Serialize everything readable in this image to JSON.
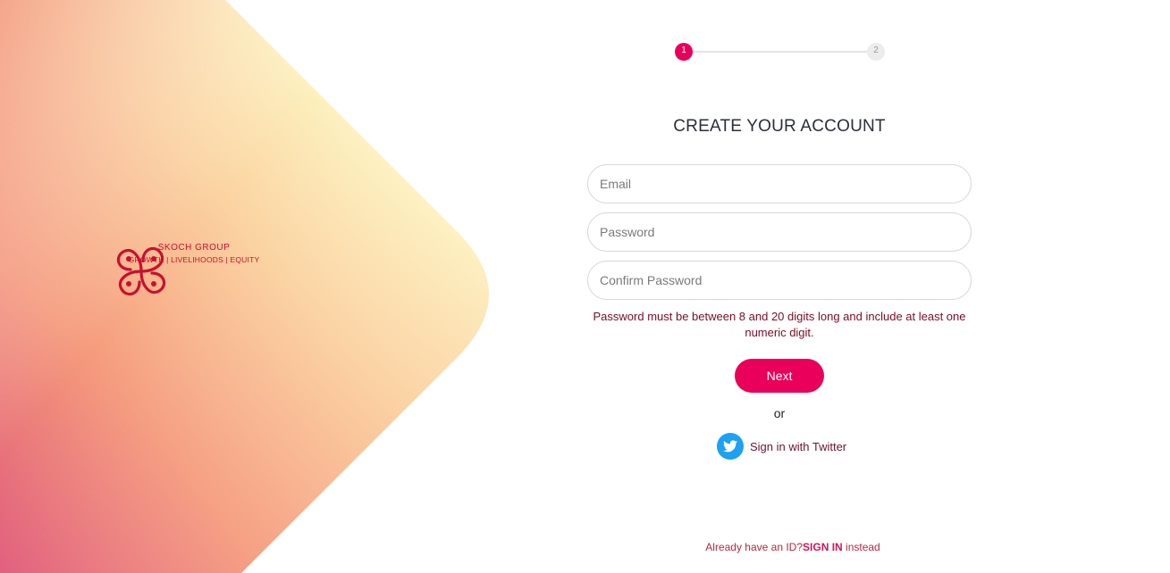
{
  "brand": {
    "name": "SKOCH GROUP",
    "tagline": "GROWTH | LIVELIHOODS | EQUITY",
    "color": "#c8102e"
  },
  "stepper": {
    "steps": [
      "1",
      "2"
    ],
    "current": 1,
    "active_color": "#e8005a"
  },
  "form": {
    "title": "CREATE YOUR ACCOUNT",
    "email_placeholder": "Email",
    "password_placeholder": "Password",
    "confirm_placeholder": "Confirm Password",
    "error": "Password must be between 8 and 20 digits long and include at least one numeric digit.",
    "next_label": "Next",
    "or_label": "or",
    "twitter_label": "Sign in with Twitter",
    "twitter_icon": "twitter-bird-icon"
  },
  "footer": {
    "prefix": "Already have an ID?",
    "link": "SIGN IN",
    "suffix": " instead"
  },
  "colors": {
    "accent": "#e8005a",
    "twitter": "#1da1f2",
    "error_text": "#7a0b25"
  }
}
